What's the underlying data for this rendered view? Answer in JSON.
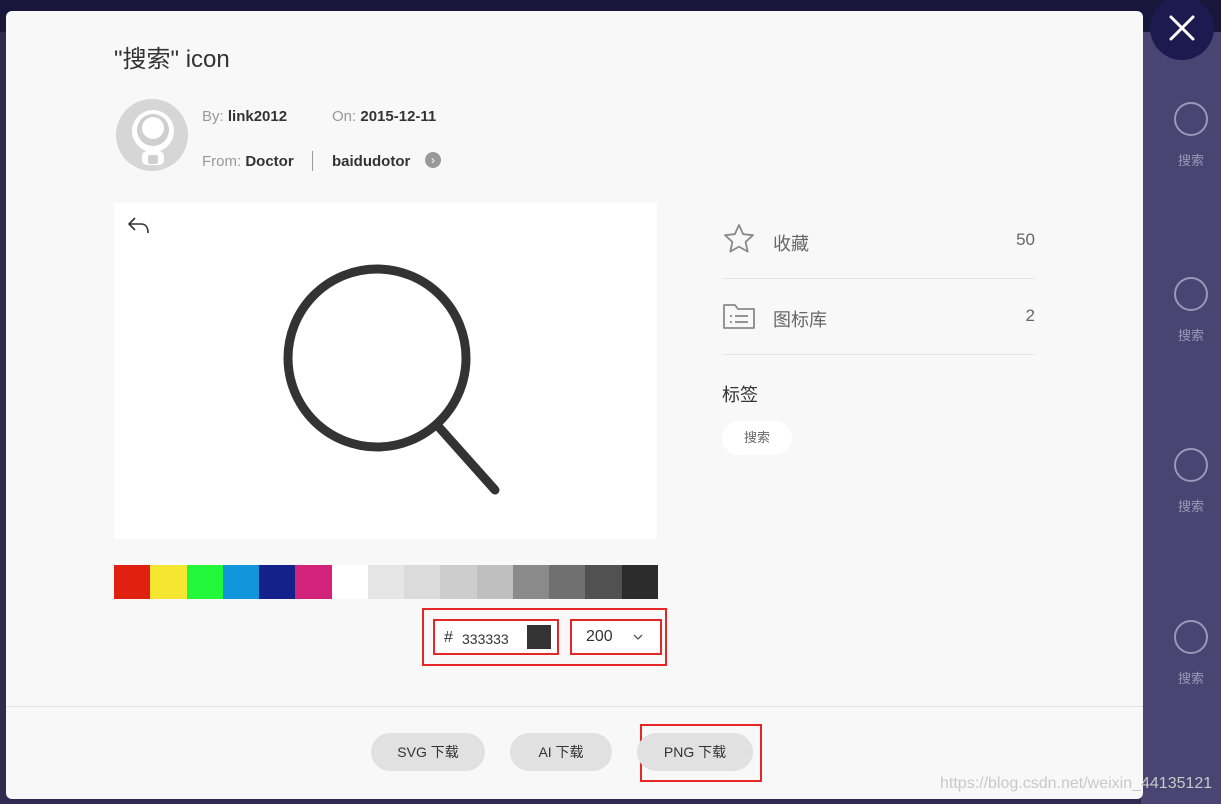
{
  "page": {
    "title": "\"搜索\" icon"
  },
  "author": {
    "by_label": "By:",
    "by_value": "link2012",
    "on_label": "On:",
    "on_value": "2015-12-11",
    "from_label": "From:",
    "from_value": "Doctor",
    "library": "baidudotor"
  },
  "palette": [
    "#e02010",
    "#f5e632",
    "#22f73a",
    "#1296db",
    "#15218a",
    "#d4237a",
    "#ffffff",
    "#e6e6e6",
    "#dbdbdb",
    "#cdcdcd",
    "#bfbfbf",
    "#8a8a8a",
    "#707070",
    "#515151",
    "#2c2c2c"
  ],
  "color": {
    "hash": "#",
    "value": "333333",
    "swatch": "#333333"
  },
  "size": {
    "value": "200"
  },
  "stats": [
    {
      "label": "收藏",
      "count": "50",
      "icon": "star-icon"
    },
    {
      "label": "图标库",
      "count": "2",
      "icon": "folder-list-icon"
    }
  ],
  "tags": {
    "heading": "标签",
    "items": [
      "搜索"
    ]
  },
  "downloads": {
    "svg": "SVG 下载",
    "ai": "AI 下载",
    "png": "PNG 下载"
  },
  "background": {
    "items": [
      "搜索",
      "搜索",
      "搜索",
      "搜索"
    ]
  },
  "watermark": "https://blog.csdn.net/weixin_44135121"
}
